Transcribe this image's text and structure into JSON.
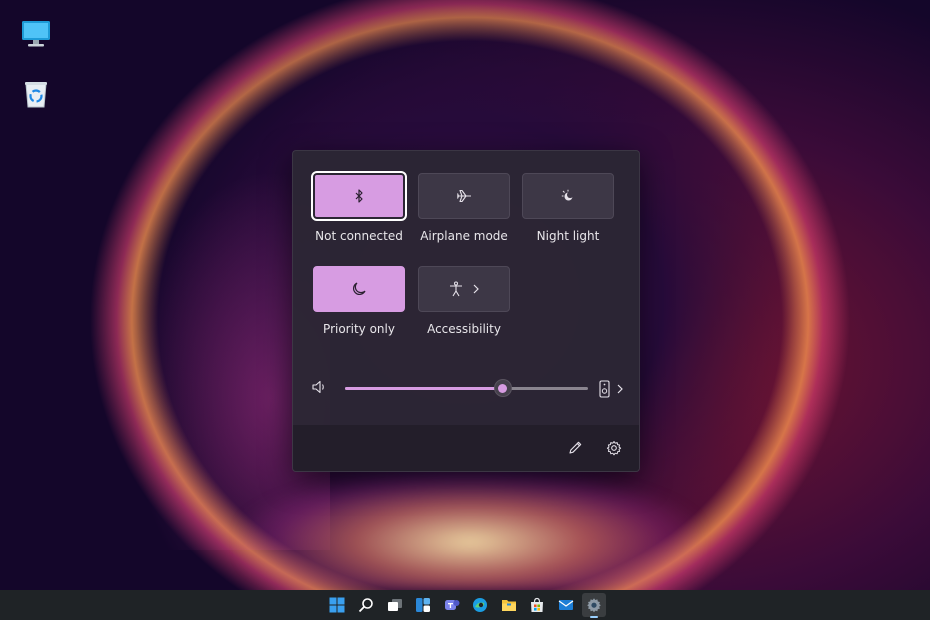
{
  "desktop": {
    "icons": [
      {
        "name": "this-pc",
        "icon": "monitor-icon"
      },
      {
        "name": "recycle-bin",
        "icon": "recycle-bin-icon"
      }
    ]
  },
  "quick_settings": {
    "tiles": [
      {
        "id": "bluetooth",
        "label": "Not connected",
        "icon": "bluetooth-icon",
        "state": "on"
      },
      {
        "id": "airplane",
        "label": "Airplane mode",
        "icon": "airplane-icon",
        "state": "off"
      },
      {
        "id": "night-light",
        "label": "Night light",
        "icon": "night-light-icon",
        "state": "off"
      },
      {
        "id": "focus-assist",
        "label": "Priority only",
        "icon": "moon-icon",
        "state": "on"
      },
      {
        "id": "accessibility",
        "label": "Accessibility",
        "icon": "accessibility-icon",
        "state": "off"
      }
    ],
    "volume": {
      "icon": "speaker-icon",
      "level": 0.65,
      "output_icon": "speaker-device-icon"
    },
    "footer": {
      "edit_icon": "pencil-icon",
      "settings_icon": "gear-icon"
    }
  },
  "taskbar": {
    "apps": [
      "start-icon",
      "search-icon",
      "task-view-icon",
      "widgets-icon",
      "chat-icon",
      "edge-icon",
      "file-explorer-icon",
      "store-icon",
      "mail-icon",
      "settings-icon"
    ],
    "active_app": "settings-icon"
  },
  "colors": {
    "accent": "#d79ce2",
    "panel_bg": "#2c2634",
    "taskbar_bg": "#1f2326"
  }
}
